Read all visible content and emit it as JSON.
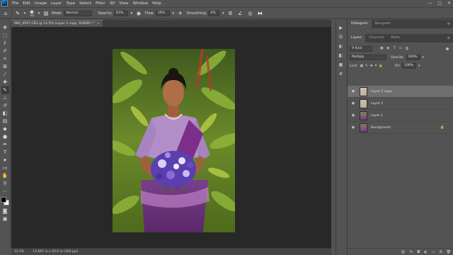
{
  "app": {
    "logo": "Ps"
  },
  "menu": [
    "File",
    "Edit",
    "Image",
    "Layer",
    "Type",
    "Select",
    "Filter",
    "3D",
    "View",
    "Window",
    "Help"
  ],
  "window_controls": {
    "minimize": "—",
    "maximize": "□",
    "close": "✕"
  },
  "options_bar": {
    "brush_size": "300",
    "mode_label": "Mode:",
    "mode_value": "Normal",
    "opacity_label": "Opacity:",
    "opacity_value": "63%",
    "flow_label": "Flow:",
    "flow_value": "30%",
    "smoothing_label": "Smoothing:",
    "smoothing_value": "0%"
  },
  "document": {
    "tab_title": "IMG_4597.CR2 @ 12.5% (Layer 2 copy, RGB/8*) *",
    "tab_close": "×"
  },
  "status_bar": {
    "zoom": "12.5%",
    "doc_info": "13.667 in x 20.6 in (300 ppi)"
  },
  "panels": {
    "top_tabs": [
      "Histogram",
      "Navigator"
    ],
    "top_active": "Histogram",
    "layer_tabs": [
      "Layers",
      "Channels",
      "Paths"
    ],
    "layer_active": "Layers",
    "kind_value": "Kind",
    "blend_mode": "Multiply",
    "opacity_label": "Opacity:",
    "opacity_value": "100%",
    "lock_label": "Lock:",
    "fill_label": "Fill:",
    "fill_value": "100%"
  },
  "layers": [
    {
      "name": "Layer 2 copy",
      "selected": true,
      "thumb": "plain",
      "italic": false
    },
    {
      "name": "Layer 2",
      "selected": false,
      "thumb": "plain",
      "italic": false
    },
    {
      "name": "Layer 1",
      "selected": false,
      "thumb": "photo",
      "italic": false
    },
    {
      "name": "Background",
      "selected": false,
      "thumb": "photo",
      "italic": true,
      "locked": true
    }
  ],
  "colors": {
    "accent": "#31a8ff",
    "canvas_bg": "#282828",
    "panel_bg": "#535353",
    "foreground_swatch": "#000000",
    "background_swatch": "#ffffff"
  }
}
